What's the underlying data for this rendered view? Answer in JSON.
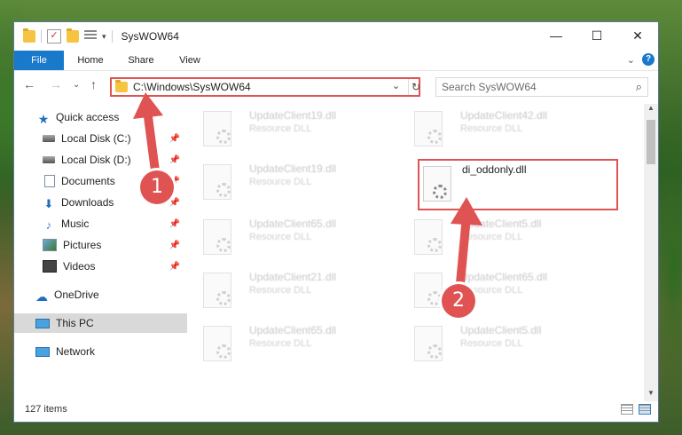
{
  "window": {
    "title": "SysWOW64",
    "controls": {
      "minimize": "—",
      "maximize": "☐",
      "close": "✕"
    }
  },
  "ribbon": {
    "tabs": [
      "File",
      "Home",
      "Share",
      "View"
    ],
    "expand": "⌄",
    "help": "?"
  },
  "nav": {
    "back": "←",
    "forward": "→",
    "recent": "⌄",
    "up": "↑",
    "address": "C:\\Windows\\SysWOW64",
    "search_placeholder": "Search SysWOW64"
  },
  "sidebar": {
    "items": [
      {
        "label": "Quick access",
        "icon": "star-icon"
      },
      {
        "label": "Local Disk (C:)",
        "icon": "drive-icon"
      },
      {
        "label": "Local Disk (D:)",
        "icon": "drive-icon"
      },
      {
        "label": "Documents",
        "icon": "documents-icon"
      },
      {
        "label": "Downloads",
        "icon": "downloads-icon"
      },
      {
        "label": "Music",
        "icon": "music-icon"
      },
      {
        "label": "Pictures",
        "icon": "pictures-icon"
      },
      {
        "label": "Videos",
        "icon": "videos-icon"
      },
      {
        "label": "OneDrive",
        "icon": "cloud-icon"
      },
      {
        "label": "This PC",
        "icon": "computer-icon"
      },
      {
        "label": "Network",
        "icon": "network-icon"
      }
    ]
  },
  "files": [
    {
      "name": "UpdateClient19.dll",
      "type": "Resource DLL"
    },
    {
      "name": "UpdateClient42.dll",
      "type": "Resource DLL"
    },
    {
      "name": "UpdateClient19.dll",
      "type": "Resource DLL"
    },
    {
      "name": "di_oddonly.dll",
      "type": ""
    },
    {
      "name": "UpdateClient65.dll",
      "type": "Resource DLL"
    },
    {
      "name": "UpdateClient5.dll",
      "type": "Resource DLL"
    },
    {
      "name": "UpdateClient21.dll",
      "type": "Resource DLL"
    },
    {
      "name": "UpdateClient65.dll",
      "type": "Resource DLL"
    },
    {
      "name": "UpdateClient65.dll",
      "type": "Resource DLL"
    },
    {
      "name": "UpdateClient5.dll",
      "type": "Resource DLL"
    }
  ],
  "status": {
    "count": "127 items"
  },
  "annotations": {
    "step1": "1",
    "step2": "2"
  },
  "colors": {
    "accent": "#1979ca",
    "highlight": "#e05353"
  }
}
